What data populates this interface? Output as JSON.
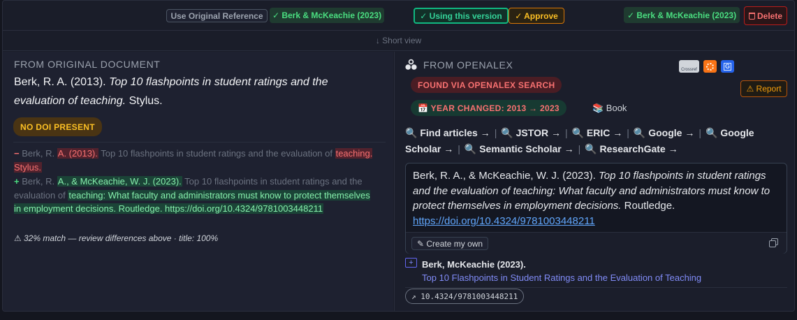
{
  "topbar": {
    "use_original": "Use Original Reference",
    "version_left": "✓ Berk & McKeachie (2023)",
    "using_version": "✓ Using this version",
    "approve": "✓ Approve",
    "version_right": "✓ Berk & McKeachie (2023)",
    "delete": "Delete"
  },
  "short_view": "↓ Short view",
  "left": {
    "title": "FROM ORIGINAL DOCUMENT",
    "citation_author": "Berk, R. A. (2013). ",
    "citation_title": "Top 10 flashpoints in student ratings and the evaluation of teaching.",
    "citation_publisher": " Stylus.",
    "badge": "NO DOI PRESENT",
    "diff_removed": {
      "marker": "−",
      "pre": " Berk, R. ",
      "del1": "A. (2013).",
      "mid": " Top 10 flashpoints in student ratings and the evaluation of ",
      "del2": "teaching. Stylus."
    },
    "diff_added": {
      "marker": "+",
      "pre": " Berk, R. ",
      "ins1": "A., & McKeachie, W. J. (2023).",
      "mid": " Top 10 flashpoints in student ratings and the evaluation of ",
      "ins2": "teaching: What faculty and administrators must know to protect themselves in employment decisions. Routledge. https://doi.org/10.4324/9781003448211"
    },
    "match_note": "⚠ 32% match — review differences above · title: 100%"
  },
  "right": {
    "title": "FROM OPENALEX",
    "badge_found": "FOUND VIA OPENALEX SEARCH",
    "badge_year": "📅 YEAR CHANGED: 2013 → 2023",
    "type_label": "📚 Book",
    "report": "⚠ Report",
    "source_icons": {
      "crossref": "Crossref",
      "openalex": "",
      "google": "G"
    },
    "links": [
      "🔍 Find articles →",
      "🔍 JSTOR →",
      "🔍 ERIC →",
      "🔍 Google →",
      "🔍 Google Scholar →",
      "🔍 Semantic Scholar →",
      "🔍 ResearchGate →"
    ],
    "ref_author": "Berk, R. A., & McKeachie, W. J. (2023). ",
    "ref_title": "Top 10 flashpoints in student ratings and the evaluation of teaching: What faculty and administrators must know to protect themselves in employment decisions.",
    "ref_publisher": " Routledge.",
    "ref_doi": "https://doi.org/10.4324/9781003448211",
    "create_own": "✎ Create my own",
    "result_authors": "Berk, McKeachie (2023).",
    "result_title": "Top 10 Flashpoints in Student Ratings and the Evaluation of Teaching",
    "doi_pill": "↗ 10.4324/9781003448211"
  },
  "colors": {
    "green": "#4ade80",
    "teal": "#34d399",
    "amber": "#f59e0b",
    "red": "#f87171",
    "link_blue": "#60a5fa",
    "purple_link": "#818cf8"
  }
}
